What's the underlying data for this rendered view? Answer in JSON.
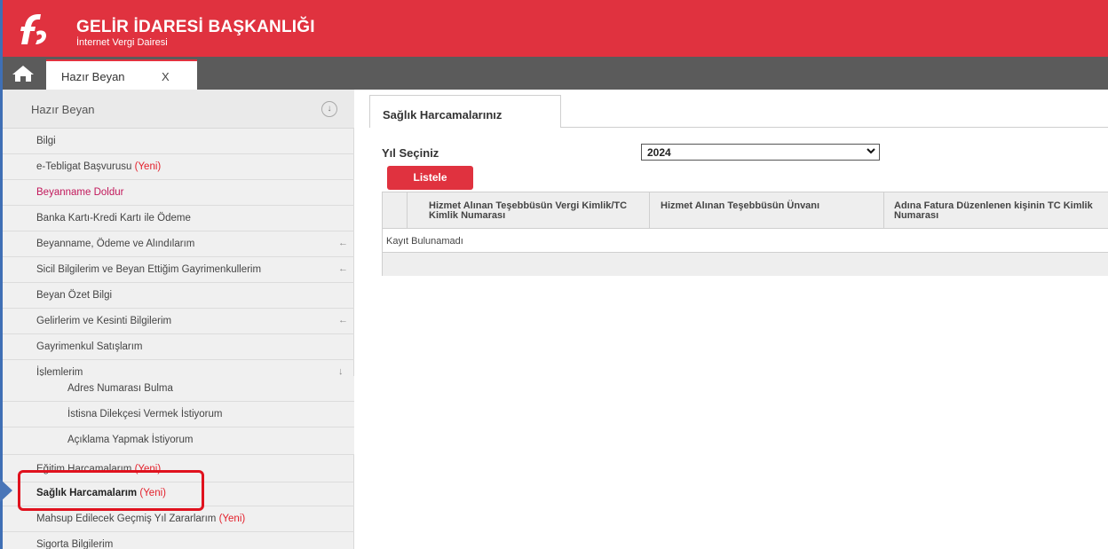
{
  "header": {
    "title": "GELİR İDARESİ BAŞKANLIĞI",
    "subtitle": "İnternet Vergi Dairesi",
    "brand_color": "#e0323f"
  },
  "tabs": {
    "home_icon": "home-icon",
    "open_tab_label": "Hazır Beyan",
    "close_label": "X"
  },
  "sidebar": {
    "header_label": "Hazır Beyan",
    "collapse_symbol": "↓",
    "items": [
      {
        "label": "Bilgi",
        "yeni": "",
        "arrow": ""
      },
      {
        "label": "e-Tebligat Başvurusu",
        "yeni": "(Yeni)",
        "arrow": ""
      },
      {
        "label": "Beyanname Doldur",
        "yeni": "",
        "arrow": ""
      },
      {
        "label": "Banka Kartı-Kredi Kartı ile Ödeme",
        "yeni": "",
        "arrow": ""
      },
      {
        "label": "Beyanname, Ödeme ve Alındılarım",
        "yeni": "",
        "arrow": "←"
      },
      {
        "label": "Sicil Bilgilerim ve Beyan Ettiğim Gayrimenkullerim",
        "yeni": "",
        "arrow": "←"
      },
      {
        "label": "Beyan Özet Bilgi",
        "yeni": "",
        "arrow": ""
      },
      {
        "label": "Gelirlerim ve Kesinti Bilgilerim",
        "yeni": "",
        "arrow": "←"
      },
      {
        "label": "Gayrimenkul Satışlarım",
        "yeni": "",
        "arrow": ""
      },
      {
        "label": "İşlemlerim",
        "yeni": "",
        "arrow": "↓"
      },
      {
        "label": "Adres Numarası Bulma",
        "yeni": "",
        "arrow": ""
      },
      {
        "label": "İstisna Dilekçesi Vermek İstiyorum",
        "yeni": "",
        "arrow": ""
      },
      {
        "label": "Açıklama Yapmak İstiyorum",
        "yeni": "",
        "arrow": ""
      },
      {
        "label": "Eğitim Harcamalarım",
        "yeni": "(Yeni)",
        "arrow": ""
      },
      {
        "label": "Sağlık Harcamalarım",
        "yeni": "(Yeni)",
        "arrow": ""
      },
      {
        "label": "Mahsup Edilecek Geçmiş Yıl Zararlarım",
        "yeni": "(Yeni)",
        "arrow": ""
      },
      {
        "label": "Sigorta Bilgilerim",
        "yeni": "",
        "arrow": ""
      }
    ]
  },
  "main": {
    "tab_label": "Sağlık Harcamalarınız",
    "year_label": "Yıl Seçiniz",
    "year_value": "2024",
    "list_button": "Listele",
    "grid": {
      "columns": [
        "Hizmet Alınan Teşebbüsün Vergi Kimlik/TC Kimlik Numarası",
        "Hizmet Alınan Teşebbüsün Ünvanı",
        "Adına Fatura Düzenlenen kişinin TC Kimlik Numarası"
      ],
      "empty_text": "Kayıt Bulunamadı"
    }
  },
  "annotation": {
    "highlight_color": "#e0121e",
    "arrow_color": "#4a76b8"
  }
}
